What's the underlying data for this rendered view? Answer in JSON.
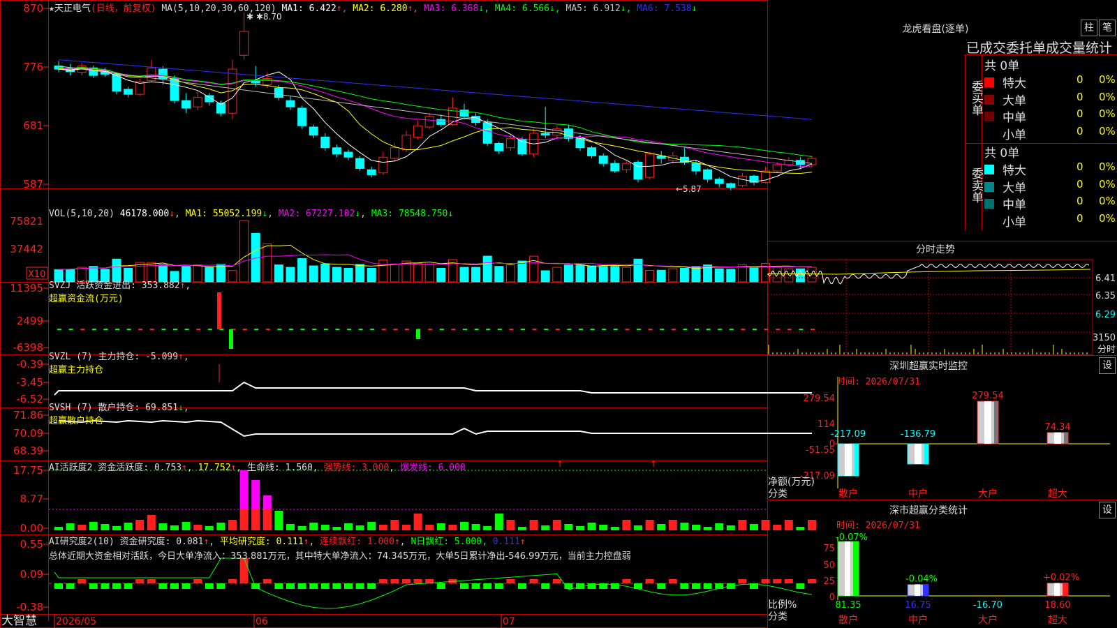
{
  "header": {
    "title": "★天正电气",
    "period": "(日线，前复权)",
    "ma_label": "MA(5,10,20,30,60,120)",
    "ma": [
      {
        "label": "MA1:",
        "value": "6.422",
        "arrow": "↑",
        "color": "#ffffff"
      },
      {
        "label": "MA2:",
        "value": "6.280",
        "arrow": "↑",
        "color": "#ffff00"
      },
      {
        "label": "MA3:",
        "value": "6.368",
        "arrow": "↓",
        "color": "#ff00ff"
      },
      {
        "label": "MA4:",
        "value": "6.566",
        "arrow": "↓",
        "color": "#00ff00"
      },
      {
        "label": "MA5:",
        "value": "6.912",
        "arrow": "↓",
        "color": "#c0c0c0"
      },
      {
        "label": "MA6:",
        "value": "7.538",
        "arrow": "↓",
        "color": "#3030ff"
      }
    ],
    "high_mark": "8.70",
    "low_mark": "5.87"
  },
  "price_axis": [
    "870",
    "776",
    "681",
    "587"
  ],
  "vol": {
    "title": "VOL(5,10,20)",
    "value": "46178.000",
    "ma1": "MA1: 55052.199",
    "ma2": "MA2: 67227.102",
    "ma3": "MA3: 78548.750",
    "axis": [
      "75821",
      "37442"
    ],
    "unit": "X10"
  },
  "svzj": {
    "title": "SVZJ  活跃资金进出: 353.882",
    "sub": "超赢资金流(万元)",
    "axis": [
      "11395",
      "2499",
      "-6398"
    ]
  },
  "svzl": {
    "title": "SVZL (7) 主力持仓: -5.099",
    "sub": "超赢主力持仓",
    "axis": [
      "-0.39",
      "-3.45",
      "-6.52"
    ]
  },
  "svsh": {
    "title": "SVSH (7) 散户持仓: 69.851",
    "sub": "超赢散户持仓",
    "axis": [
      "71.86",
      "70.09",
      "68.39"
    ]
  },
  "ai_act": {
    "title": "AI活跃度2 资金活跃度: 0.753",
    "v2": "17.752",
    "life": "生命线: 1.560",
    "strong": "强势线: 3.000",
    "burst": "爆发线: 6.000",
    "axis": [
      "17.75",
      "8.77",
      "0.00"
    ]
  },
  "ai_res": {
    "title": "AI研究度2(10) 资金研究度: 0.081",
    "avg": "平均研究度: 0.111",
    "red": "连续飘红: 1.000",
    "nred": "N日飘红: 5.000,",
    "last": "0.111",
    "summary": "总体近期大资金相对活跃，今日大单净流入：353.881万元，其中特大单净流入：74.345万元，大单5日累计净出-546.99万元，当前主力控盘弱",
    "axis": [
      "0.55",
      "0.09",
      "-0.38"
    ]
  },
  "date_axis": {
    "brand": "大智慧",
    "labels": [
      "2026/05",
      "06",
      "07"
    ]
  },
  "dragon": {
    "title": "龙虎看盘(逐单)",
    "btn1": "柱",
    "btn2": "笔",
    "subtitle": "已成交委托单成交量统计",
    "buy": {
      "side": "委买单",
      "total": "共 0单",
      "rows": [
        {
          "name": "特大",
          "n": "0",
          "p": "0%",
          "color": "#ff0000"
        },
        {
          "name": "大单",
          "n": "0",
          "p": "0%",
          "color": "#8b0000"
        },
        {
          "name": "中单",
          "n": "0",
          "p": "0%",
          "color": "#700000"
        },
        {
          "name": "小单",
          "n": "0",
          "p": "0%",
          "color": "#000000"
        }
      ]
    },
    "sell": {
      "side": "委卖单",
      "total": "共 0单",
      "rows": [
        {
          "name": "特大",
          "n": "0",
          "p": "0%",
          "color": "#00ffff"
        },
        {
          "name": "大单",
          "n": "0",
          "p": "0%",
          "color": "#008888"
        },
        {
          "name": "中单",
          "n": "0",
          "p": "0%",
          "color": "#007070"
        },
        {
          "name": "小单",
          "n": "0",
          "p": "0%",
          "color": "#000000"
        }
      ]
    }
  },
  "minute": {
    "title": "分时走势",
    "axis": [
      "6.41",
      "6.35",
      "6.29",
      "3150"
    ],
    "label": "分时"
  },
  "sz_monitor": {
    "title": "深圳超赢实时监控",
    "btn": "设",
    "time": "时间: 2026/07/31",
    "axis": [
      "279.54",
      "114",
      "-51.55",
      "-217.09"
    ],
    "ylabel": "净额(万元)",
    "xlabel": "分类"
  },
  "sz_class": {
    "title": "深市超赢分类统计",
    "btn": "设",
    "time": "时间: 2026/07/31",
    "axis": [
      "75",
      "50",
      "25",
      "0"
    ],
    "ylabel": "比例%",
    "xlabel": "分类"
  },
  "chart_data": [
    {
      "type": "bar",
      "title": "深圳超赢实时监控",
      "categories": [
        "散户",
        "中户",
        "大户",
        "超大"
      ],
      "values": [
        -217.09,
        -136.79,
        279.54,
        74.34
      ],
      "ylim": [
        -217.09,
        279.54
      ]
    },
    {
      "type": "bar",
      "title": "深市超赢分类统计",
      "categories": [
        "散户",
        "中户",
        "大户",
        "超大"
      ],
      "values": [
        81.35,
        16.75,
        -16.7,
        18.6
      ],
      "changes": [
        "-0.07%",
        "-0.04%",
        "",
        "+0.02%"
      ],
      "ylim": [
        0,
        75
      ]
    },
    {
      "type": "line",
      "title": "天正电气 日线",
      "x": [
        "2026/05",
        "06",
        "07"
      ],
      "series": [
        {
          "name": "MA1",
          "values": [
            6.422
          ]
        },
        {
          "name": "MA2",
          "values": [
            6.28
          ]
        },
        {
          "name": "MA3",
          "values": [
            6.368
          ]
        },
        {
          "name": "MA4",
          "values": [
            6.566
          ]
        },
        {
          "name": "MA5",
          "values": [
            6.912
          ]
        },
        {
          "name": "MA6",
          "values": [
            7.538
          ]
        }
      ],
      "ylim": [
        5.87,
        8.7
      ]
    }
  ],
  "candles": [
    [
      7.85,
      7.8,
      7.93,
      7.75
    ],
    [
      7.82,
      7.76,
      7.88,
      7.7
    ],
    [
      7.75,
      7.85,
      7.9,
      7.7
    ],
    [
      7.82,
      7.7,
      7.86,
      7.66
    ],
    [
      7.78,
      7.72,
      7.82,
      7.68
    ],
    [
      7.72,
      7.45,
      7.75,
      7.4
    ],
    [
      7.48,
      7.4,
      7.52,
      7.35
    ],
    [
      7.4,
      7.6,
      7.65,
      7.38
    ],
    [
      7.62,
      7.82,
      7.95,
      7.6
    ],
    [
      7.8,
      7.65,
      7.85,
      7.55
    ],
    [
      7.65,
      7.3,
      7.7,
      7.25
    ],
    [
      7.3,
      7.18,
      7.42,
      7.1
    ],
    [
      7.2,
      7.35,
      7.45,
      7.15
    ],
    [
      7.38,
      7.28,
      7.42,
      7.22
    ],
    [
      7.26,
      7.1,
      7.3,
      7.05
    ],
    [
      7.1,
      7.8,
      7.95,
      7.0
    ],
    [
      8.02,
      8.4,
      8.7,
      7.95
    ],
    [
      7.62,
      7.58,
      7.85,
      7.52
    ],
    [
      7.55,
      7.65,
      7.75,
      7.5
    ],
    [
      7.5,
      7.35,
      7.55,
      7.3
    ],
    [
      7.3,
      7.2,
      7.38,
      7.15
    ],
    [
      7.18,
      6.9,
      7.22,
      6.85
    ],
    [
      6.88,
      6.75,
      6.92,
      6.7
    ],
    [
      6.72,
      6.55,
      6.78,
      6.5
    ],
    [
      6.55,
      6.45,
      6.6,
      6.4
    ],
    [
      6.48,
      6.4,
      6.52,
      6.35
    ],
    [
      6.38,
      6.22,
      6.42,
      6.18
    ],
    [
      6.2,
      6.12,
      6.25,
      6.08
    ],
    [
      6.15,
      6.4,
      6.48,
      6.12
    ],
    [
      6.38,
      6.55,
      6.62,
      6.33
    ],
    [
      6.52,
      6.75,
      6.82,
      6.48
    ],
    [
      6.72,
      6.9,
      6.98,
      6.68
    ],
    [
      6.88,
      7.05,
      7.1,
      6.85
    ],
    [
      7.0,
      6.92,
      7.08,
      6.88
    ],
    [
      6.92,
      7.18,
      7.35,
      6.9
    ],
    [
      7.15,
      7.05,
      7.25,
      7.0
    ],
    [
      7.05,
      6.95,
      7.1,
      6.9
    ],
    [
      6.95,
      6.62,
      7.0,
      6.58
    ],
    [
      6.62,
      6.5,
      6.65,
      6.45
    ],
    [
      6.55,
      6.7,
      6.75,
      6.5
    ],
    [
      6.68,
      6.45,
      6.72,
      6.42
    ],
    [
      6.45,
      6.78,
      6.85,
      6.4
    ],
    [
      6.78,
      6.75,
      7.2,
      6.7
    ],
    [
      6.75,
      6.85,
      6.9,
      6.7
    ],
    [
      6.85,
      6.7,
      6.92,
      6.65
    ],
    [
      6.7,
      6.55,
      6.75,
      6.5
    ],
    [
      6.55,
      6.42,
      6.58,
      6.38
    ],
    [
      6.42,
      6.3,
      6.46,
      6.25
    ],
    [
      6.3,
      6.18,
      6.35,
      6.15
    ],
    [
      6.2,
      6.3,
      6.35,
      6.15
    ],
    [
      6.32,
      6.05,
      6.35,
      6.0
    ],
    [
      6.08,
      6.45,
      6.48,
      6.05
    ],
    [
      6.42,
      6.38,
      6.5,
      6.3
    ],
    [
      6.35,
      6.42,
      6.48,
      6.3
    ],
    [
      6.4,
      6.32,
      6.55,
      6.28
    ],
    [
      6.3,
      6.18,
      6.35,
      6.12
    ],
    [
      6.2,
      6.05,
      6.22,
      6.0
    ],
    [
      6.05,
      5.98,
      6.08,
      5.92
    ],
    [
      5.98,
      5.92,
      6.0,
      5.87
    ],
    [
      5.95,
      6.1,
      6.15,
      5.92
    ],
    [
      6.1,
      6.0,
      6.12,
      5.95
    ],
    [
      6.0,
      6.18,
      6.25,
      5.98
    ],
    [
      6.18,
      6.28,
      6.32,
      6.15
    ],
    [
      6.28,
      6.35,
      6.4,
      6.25
    ],
    [
      6.35,
      6.28,
      6.4,
      6.22
    ],
    [
      6.28,
      6.38,
      6.42,
      6.25
    ]
  ]
}
